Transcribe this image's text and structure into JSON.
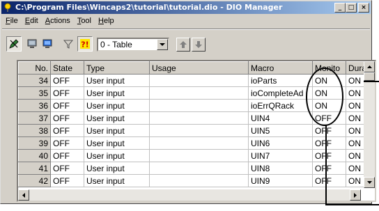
{
  "window": {
    "title": "C:\\Program Files\\Wincaps2\\tutorial\\tutorial.dio - DIO Manager",
    "controls": [
      "_",
      "□",
      "×"
    ]
  },
  "menu": [
    {
      "key": "F",
      "rest": "ile"
    },
    {
      "key": "E",
      "rest": "dit"
    },
    {
      "key": "A",
      "rest": "ctions"
    },
    {
      "key": "T",
      "rest": "ool"
    },
    {
      "key": "H",
      "rest": "elp"
    }
  ],
  "toolbar": {
    "view_value": "0 - Table"
  },
  "grid": {
    "columns": [
      "No.",
      "State",
      "Type",
      "Usage",
      "Macro",
      "Monito",
      "Dura"
    ],
    "rows": [
      {
        "no": "34",
        "state": "OFF",
        "type": "User input",
        "usage": "",
        "macro": "ioParts",
        "monitor": "ON",
        "dura": "ON"
      },
      {
        "no": "35",
        "state": "OFF",
        "type": "User input",
        "usage": "",
        "macro": "ioCompleteAd",
        "monitor": "ON",
        "dura": "ON"
      },
      {
        "no": "36",
        "state": "OFF",
        "type": "User input",
        "usage": "",
        "macro": "ioErrQRack",
        "monitor": "ON",
        "dura": "ON"
      },
      {
        "no": "37",
        "state": "OFF",
        "type": "User input",
        "usage": "",
        "macro": "UIN4",
        "monitor": "OFF",
        "dura": "ON"
      },
      {
        "no": "38",
        "state": "OFF",
        "type": "User input",
        "usage": "",
        "macro": "UIN5",
        "monitor": "OFF",
        "dura": "ON"
      },
      {
        "no": "39",
        "state": "OFF",
        "type": "User input",
        "usage": "",
        "macro": "UIN6",
        "monitor": "OFF",
        "dura": "ON"
      },
      {
        "no": "40",
        "state": "OFF",
        "type": "User input",
        "usage": "",
        "macro": "UIN7",
        "monitor": "OFF",
        "dura": "ON"
      },
      {
        "no": "41",
        "state": "OFF",
        "type": "User input",
        "usage": "",
        "macro": "UIN8",
        "monitor": "OFF",
        "dura": "ON"
      },
      {
        "no": "42",
        "state": "OFF",
        "type": "User input",
        "usage": "",
        "macro": "UIN9",
        "monitor": "OFF",
        "dura": "ON"
      }
    ]
  },
  "colors": {
    "titlebar_start": "#0a246a",
    "titlebar_end": "#a6caf0",
    "chrome": "#d4d0c8"
  },
  "icons": [
    "app-icon",
    "edit-pen-icon",
    "io-monitor-icon",
    "display-icon",
    "filter-icon",
    "alert-icon",
    "up-arrow-icon",
    "down-arrow-icon"
  ]
}
